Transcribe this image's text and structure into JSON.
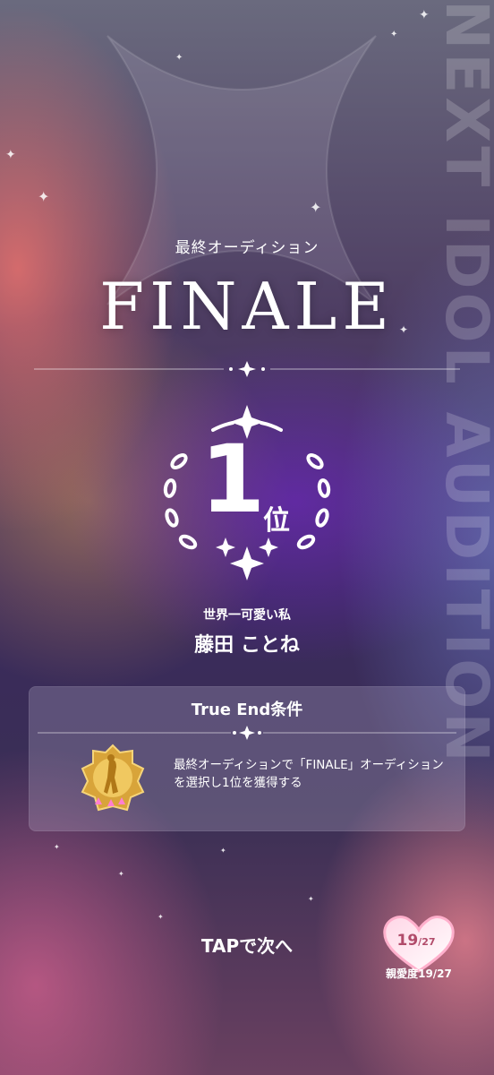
{
  "background": {
    "vertical_text": "NEXT IDOL AUDITION"
  },
  "header": {
    "subtitle": "最終オーディション",
    "title": "FINALE"
  },
  "rank": {
    "number": "1",
    "suffix": "位"
  },
  "idol": {
    "epithet": "世界一可愛い私",
    "name": "藤田 ことね"
  },
  "true_end_panel": {
    "title": "True End条件",
    "condition": "最終オーディションで「FINALE」オーディションを選択し1位を獲得する",
    "badge_icon": "gold-trophy-badge-icon"
  },
  "footer": {
    "tap_label": "TAPで次へ",
    "affinity_current": "19",
    "affinity_max": "/27",
    "affinity_label": "親愛度19/27"
  },
  "colors": {
    "heart_text": "#b14b6a",
    "panel_bg": "rgba(200,190,220,0.25)"
  }
}
